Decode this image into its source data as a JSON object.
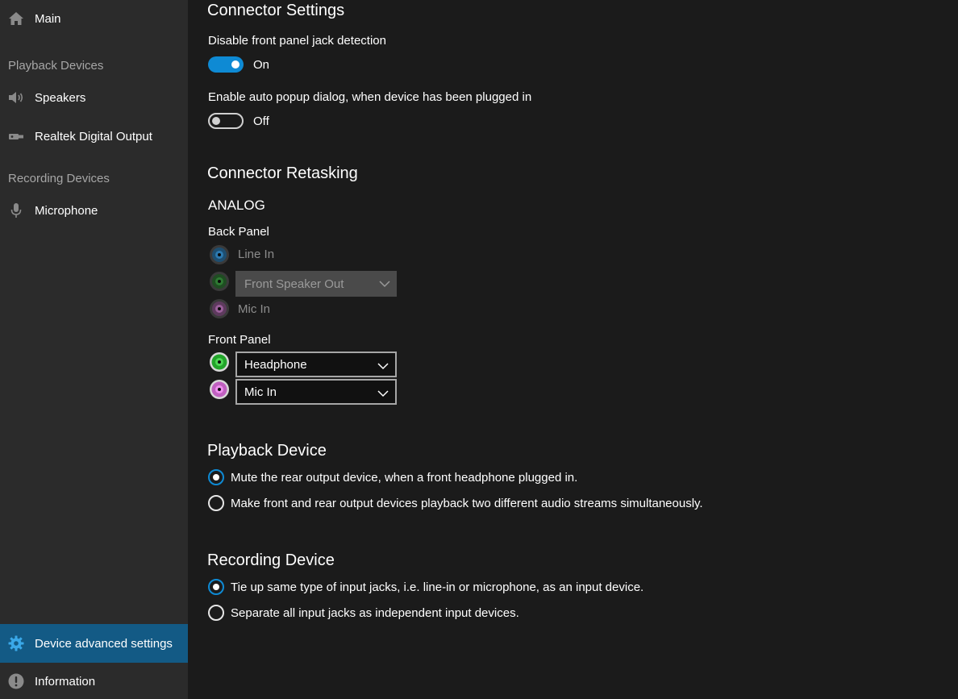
{
  "sidebar": {
    "main_label": "Main",
    "playback_header": "Playback Devices",
    "speakers_label": "Speakers",
    "digital_output_label": "Realtek Digital Output",
    "recording_header": "Recording Devices",
    "microphone_label": "Microphone",
    "advanced_label": "Device advanced settings",
    "information_label": "Information"
  },
  "connector_settings": {
    "title": "Connector Settings",
    "jack_detection_label": "Disable front panel jack detection",
    "jack_detection_state": "On",
    "auto_popup_label": "Enable auto popup dialog, when device has been plugged in",
    "auto_popup_state": "Off"
  },
  "retasking": {
    "title": "Connector Retasking",
    "analog_label": "ANALOG",
    "back_panel_label": "Back Panel",
    "back_line_in": "Line In",
    "back_speaker_select": "Front Speaker Out",
    "back_mic_in": "Mic In",
    "front_panel_label": "Front Panel",
    "front_headphone_select": "Headphone",
    "front_mic_select": "Mic In"
  },
  "playback_device": {
    "title": "Playback Device",
    "option_mute": "Mute the rear output device, when a front headphone plugged in.",
    "option_two_streams": "Make front and rear output devices playback two different audio streams simultaneously."
  },
  "recording_device": {
    "title": "Recording Device",
    "option_tie": "Tie up same type of input jacks, i.e. line-in or microphone, as an input device.",
    "option_separate": "Separate all input jacks as independent input devices."
  },
  "colors": {
    "accent": "#0e8ad4",
    "sidebar_active": "#135a85",
    "sidebar_bg": "#2b2b2b",
    "main_bg": "#1b1b1b"
  }
}
